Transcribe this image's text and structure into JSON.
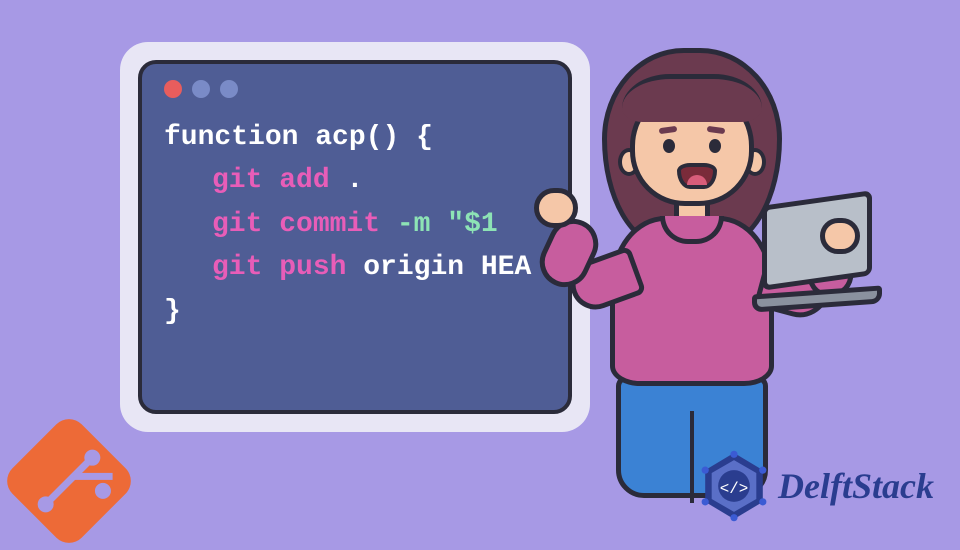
{
  "terminal": {
    "line1_function": "function",
    "line1_name": "acp()",
    "line1_brace": "{",
    "line2_cmd": "git add",
    "line2_args": ".",
    "line3_cmd": "git commit",
    "line3_flag": "-m",
    "line3_str": "\"$1",
    "line4_cmd": "git push",
    "line4_args": "origin HEA",
    "line5_brace": "}"
  },
  "brand": {
    "name": "DelftStack"
  },
  "colors": {
    "bg": "#a799e5",
    "terminal_bg": "#4f5d95",
    "keyword": "#ffffff",
    "command": "#e85db8",
    "string": "#8de3b5",
    "git": "#ed6a37",
    "delft": "#2a3d8f"
  }
}
